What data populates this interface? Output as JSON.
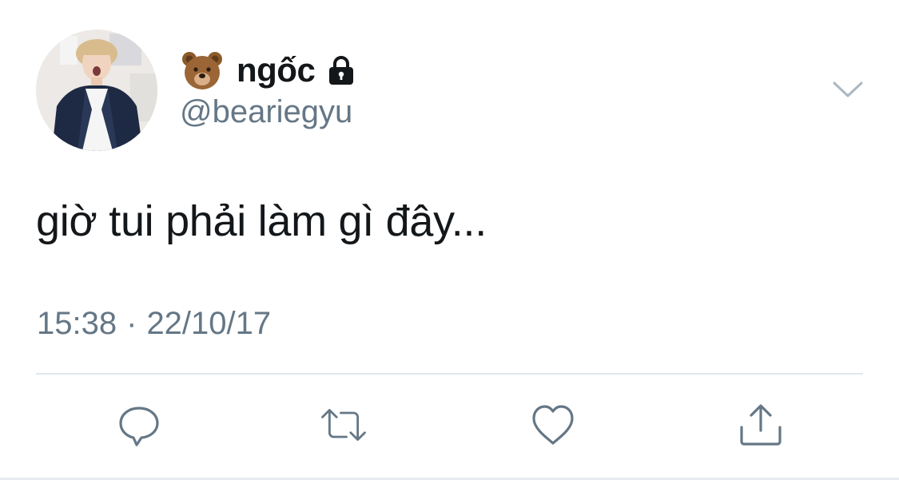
{
  "tweet": {
    "author": {
      "display_name": "ngốc",
      "handle": "@beariegyu",
      "name_prefix_icon": "bear-face-emoji",
      "protected_icon": "lock-icon"
    },
    "text": "giờ tui phải làm gì đây...",
    "time": "15:38",
    "separator": "·",
    "date": "22/10/17"
  },
  "actions": [
    {
      "name": "reply",
      "icon": "comment-bubble-icon"
    },
    {
      "name": "retweet",
      "icon": "retweet-icon"
    },
    {
      "name": "like",
      "icon": "heart-icon"
    },
    {
      "name": "share",
      "icon": "share-upload-icon"
    }
  ],
  "colors": {
    "text_primary": "#14171a",
    "text_secondary": "#657786",
    "icon": "#657786",
    "divider": "#e1e8ed",
    "background": "#ffffff"
  }
}
